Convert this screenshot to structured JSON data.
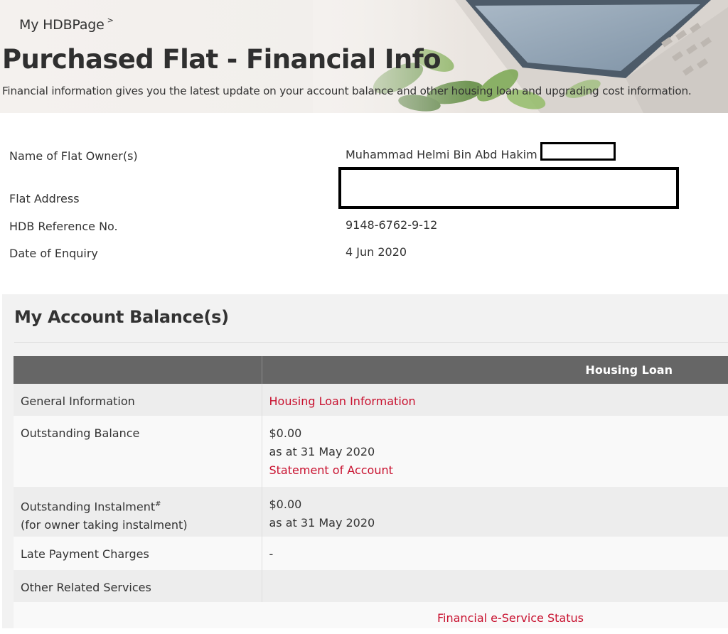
{
  "breadcrumb": {
    "label": "My HDBPage",
    "chevron": ">"
  },
  "page": {
    "title": "Purchased Flat - Financial Info",
    "subtitle": "Financial information gives you the latest update on your account balance and other housing loan and upgrading cost information."
  },
  "owner_info": {
    "rows": [
      {
        "label": "Name of Flat Owner(s)",
        "value": "Muhammad Helmi Bin Abd Hakim"
      },
      {
        "label": "Flat Address",
        "value": ""
      },
      {
        "label": "HDB Reference No.",
        "value": "9148-6762-9-12"
      },
      {
        "label": "Date of Enquiry",
        "value": "4 Jun 2020"
      }
    ]
  },
  "account_balance": {
    "title": "My Account Balance(s)",
    "table": {
      "headers": [
        "",
        "Housing Loan"
      ],
      "rows": [
        {
          "label": "General Information",
          "link": "Housing Loan Information"
        },
        {
          "label": "Outstanding Balance",
          "amount": "$0.00",
          "as_at": "as at 31 May 2020",
          "link": "Statement of Account"
        },
        {
          "label": "Outstanding Instalment",
          "label_sup": "#",
          "label_note": "(for owner taking instalment)",
          "amount": "$0.00",
          "as_at": "as at 31 May 2020"
        },
        {
          "label": "Late Payment Charges",
          "value": "-"
        },
        {
          "label": "Other Related Services",
          "value": ""
        }
      ]
    },
    "footer_link": "Financial e-Service Status"
  },
  "colors": {
    "link": "#c8102e",
    "table_header_bg": "#666666",
    "panel_bg": "#f2f2f2",
    "title_text": "#2f2f2f"
  }
}
